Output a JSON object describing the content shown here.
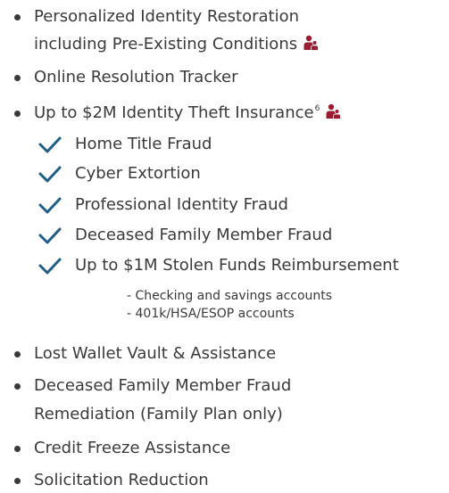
{
  "colors": {
    "text": "#3a3a3a",
    "check": "#1f5f86",
    "family_icon": "#9b1b30"
  },
  "icons": {
    "check": "check-icon",
    "family": "family-icon"
  },
  "features": {
    "restoration_line1": "Personalized Identity Restoration",
    "restoration_line2": "including Pre-Existing Conditions",
    "tracker": "Online Resolution Tracker",
    "insurance": "Up to $2M Identity Theft Insurance",
    "insurance_footnote": "6",
    "insurance_items": [
      "Home Title Fraud",
      "Cyber Extortion",
      "Professional Identity Fraud",
      "Deceased Family Member Fraud",
      "Up to $1M Stolen Funds Reimbursement"
    ],
    "funds_sub_items": [
      "- Checking and savings accounts",
      "- 401k/HSA/ESOP accounts"
    ],
    "lost_wallet": "Lost Wallet Vault & Assistance",
    "deceased_line1": "Deceased Family Member Fraud",
    "deceased_line2": "Remediation (Family Plan only)",
    "credit_freeze": "Credit Freeze Assistance",
    "solicitation": "Solicitation Reduction"
  }
}
